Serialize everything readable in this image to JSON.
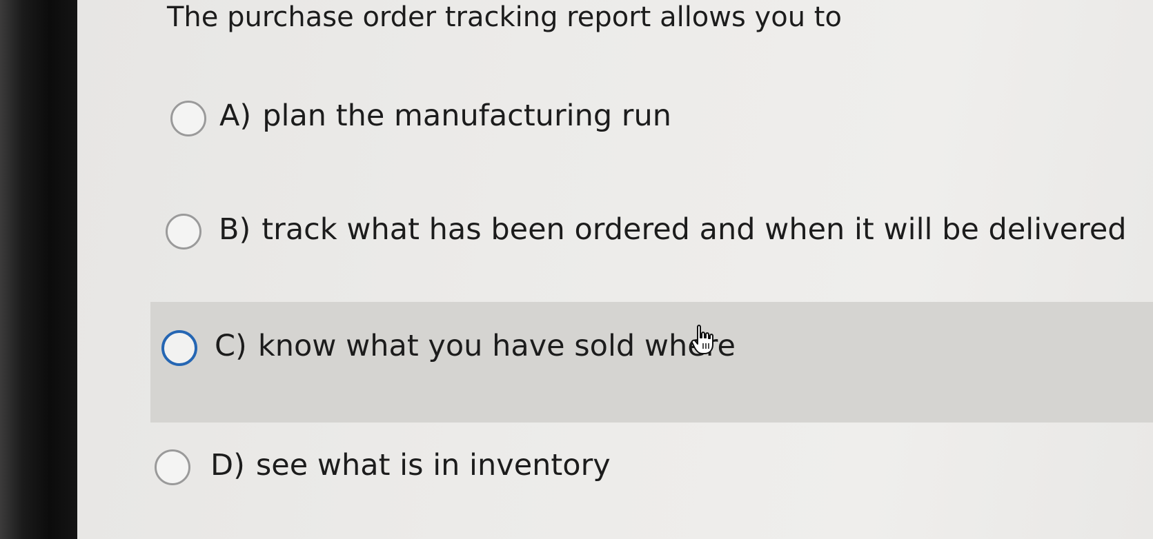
{
  "question": {
    "text": "The purchase order tracking report  allows you to"
  },
  "options": [
    {
      "letter": "A)",
      "text": "plan the manufacturing run",
      "selected": false
    },
    {
      "letter": "B)",
      "text": "track what has been ordered and when it will be delivered",
      "selected": false
    },
    {
      "letter": "C)",
      "text": "know what you have sold where",
      "selected": false,
      "hovered": true
    },
    {
      "letter": "D)",
      "text": "see what is in inventory",
      "selected": false
    }
  ],
  "colors": {
    "focus_ring": "#2566b3",
    "hover_band": "#d5d4d1",
    "text": "#1c1c1c"
  },
  "icons": {
    "cursor": "hand-pointer-icon"
  }
}
